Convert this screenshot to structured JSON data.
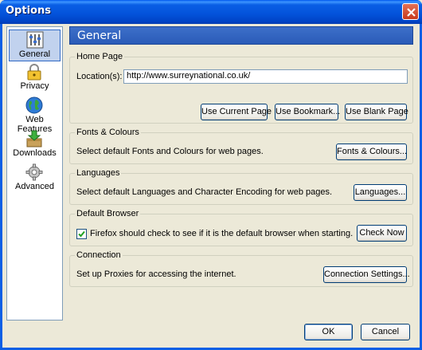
{
  "window": {
    "title": "Options"
  },
  "sidebar": {
    "items": [
      {
        "label": "General",
        "icon": "sliders-icon",
        "selected": true
      },
      {
        "label": "Privacy",
        "icon": "padlock-icon",
        "selected": false
      },
      {
        "label": "Web Features",
        "icon": "globe-icon",
        "selected": false
      },
      {
        "label": "Downloads",
        "icon": "download-box-icon",
        "selected": false
      },
      {
        "label": "Advanced",
        "icon": "gear-icon",
        "selected": false
      }
    ]
  },
  "panel": {
    "title": "General"
  },
  "home_page": {
    "group_label": "Home Page",
    "location_label": "Location(s):",
    "location_value": "http://www.surreynational.co.uk/",
    "use_current_label": "Use Current Page",
    "use_bookmark_label": "Use Bookmark...",
    "use_blank_label": "Use Blank Page"
  },
  "fonts": {
    "group_label": "Fonts & Colours",
    "description": "Select default Fonts and Colours for web pages.",
    "button_label": "Fonts & Colours..."
  },
  "languages": {
    "group_label": "Languages",
    "description": "Select default Languages and Character Encoding for web pages.",
    "button_label": "Languages..."
  },
  "default_browser": {
    "group_label": "Default Browser",
    "checkbox_label": "Firefox should check to see if it is the default browser when starting.",
    "checked": true,
    "button_label": "Check Now"
  },
  "connection": {
    "group_label": "Connection",
    "description": "Set up Proxies for accessing the internet.",
    "button_label": "Connection Settings..."
  },
  "footer": {
    "ok_label": "OK",
    "cancel_label": "Cancel"
  },
  "colors": {
    "title_bar": "#0A5FE5",
    "header_bar": "#2F5FBA",
    "dialog_bg": "#ECE9D8",
    "selection": "#C1D2EE"
  }
}
